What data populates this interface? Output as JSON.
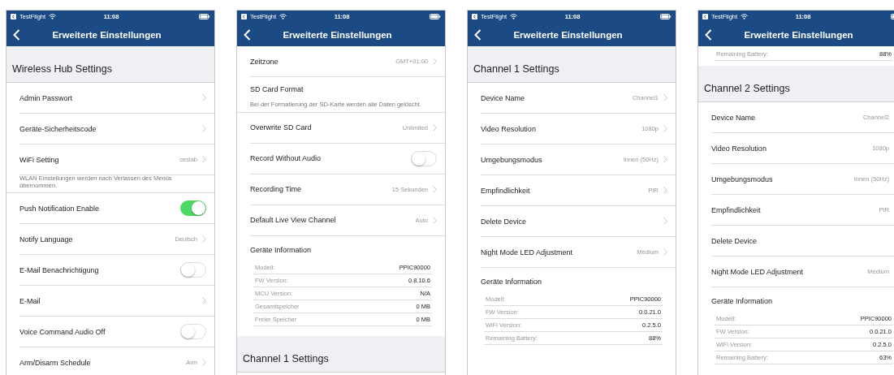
{
  "phones": [
    {
      "status": {
        "app": "TestFlight",
        "time": "11:08"
      },
      "title": "Erweiterte Einstellungen",
      "blocks": [
        {
          "kind": "header",
          "text": "Wireless Hub Settings"
        },
        {
          "kind": "link",
          "label": "Admin Passwort"
        },
        {
          "kind": "link",
          "label": "Geräte-Sicherheitscode"
        },
        {
          "kind": "link",
          "label": "WiFi Setting",
          "value": "ceslab"
        },
        {
          "kind": "note",
          "text": "WLAN Einstellungen werden nach Verlassen des Menüs übernommen."
        },
        {
          "kind": "toggle",
          "label": "Push Notification Enable",
          "on": true
        },
        {
          "kind": "link",
          "label": "Notify Language",
          "value": "Deutsch"
        },
        {
          "kind": "toggle",
          "label": "E-Mail Benachrichtigung",
          "on": false
        },
        {
          "kind": "link",
          "label": "E-Mail"
        },
        {
          "kind": "toggle",
          "label": "Voice Command Audio Off",
          "on": false
        },
        {
          "kind": "link",
          "label": "Arm/Disarm Schedule",
          "value": "Arm"
        }
      ]
    },
    {
      "status": {
        "app": "TestFlight",
        "time": "11:08"
      },
      "title": "Erweiterte Einstellungen",
      "blocks": [
        {
          "kind": "link",
          "label": "Zeitzone",
          "value": "GMT+01:00"
        },
        {
          "kind": "plain",
          "label": "SD Card Format"
        },
        {
          "kind": "note",
          "text": "Bei der Formatierung der SD-Karte werden alle Daten gelöscht."
        },
        {
          "kind": "link",
          "label": "Overwrite SD Card",
          "value": "Unlimited"
        },
        {
          "kind": "toggle",
          "label": "Record Without Audio",
          "on": false
        },
        {
          "kind": "link",
          "label": "Recording Time",
          "value": "15 Sekunden"
        },
        {
          "kind": "link",
          "label": "Default Live View Channel",
          "value": "Auto"
        },
        {
          "kind": "info",
          "title": "Geräte Information",
          "items": [
            {
              "label": "Modell:",
              "value": "PPIC90000"
            },
            {
              "label": "FW Version:",
              "value": "0.8.10.6"
            },
            {
              "label": "MCU Version:",
              "value": "N/A"
            },
            {
              "label": "Gesamtspeicher",
              "value": "0 MB"
            },
            {
              "label": "Freier Speicher",
              "value": "0 MB"
            }
          ]
        },
        {
          "kind": "header",
          "text": "Channel 1 Settings"
        }
      ]
    },
    {
      "status": {
        "app": "TestFlight",
        "time": "11:08"
      },
      "title": "Erweiterte Einstellungen",
      "blocks": [
        {
          "kind": "header",
          "text": "Channel 1 Settings"
        },
        {
          "kind": "link",
          "label": "Device Name",
          "value": "Channel1"
        },
        {
          "kind": "link",
          "label": "Video Resolution",
          "value": "1080p"
        },
        {
          "kind": "link",
          "label": "Umgebungsmodus",
          "value": "Innen (50Hz)"
        },
        {
          "kind": "link",
          "label": "Empfindlichkeit",
          "value": "PIR"
        },
        {
          "kind": "link",
          "label": "Delete Device"
        },
        {
          "kind": "link",
          "label": "Night Mode LED Adjustment",
          "value": "Medium"
        },
        {
          "kind": "info",
          "title": "Geräte Information",
          "items": [
            {
              "label": "Modell:",
              "value": "PPIC90000"
            },
            {
              "label": "FW Version:",
              "value": "0.0.21.0"
            },
            {
              "label": "WiFi Version:",
              "value": "0.2.5.0"
            },
            {
              "label": "Remaining Battery:",
              "value": "88%"
            }
          ]
        }
      ]
    },
    {
      "status": {
        "app": "TestFlight",
        "time": "11:08"
      },
      "title": "Erweiterte Einstellungen",
      "blocks": [
        {
          "kind": "info",
          "items": [
            {
              "label": "Remaining Battery:",
              "value": "88%"
            }
          ]
        },
        {
          "kind": "header",
          "text": "Channel 2 Settings"
        },
        {
          "kind": "link",
          "label": "Device Name",
          "value": "Channel2"
        },
        {
          "kind": "link",
          "label": "Video Resolution",
          "value": "1080p"
        },
        {
          "kind": "link",
          "label": "Umgebungsmodus",
          "value": "Innen (50Hz)"
        },
        {
          "kind": "link",
          "label": "Empfindlichkeit",
          "value": "PIR"
        },
        {
          "kind": "link",
          "label": "Delete Device"
        },
        {
          "kind": "link",
          "label": "Night Mode LED Adjustment",
          "value": "Medium"
        },
        {
          "kind": "info",
          "title": "Geräte Information",
          "items": [
            {
              "label": "Modell:",
              "value": "PPIC90000"
            },
            {
              "label": "FW Version:",
              "value": "0.0.21.0"
            },
            {
              "label": "WiFi Version:",
              "value": "0.2.5.0"
            },
            {
              "label": "Remaining Battery:",
              "value": "63%"
            }
          ]
        }
      ]
    }
  ]
}
